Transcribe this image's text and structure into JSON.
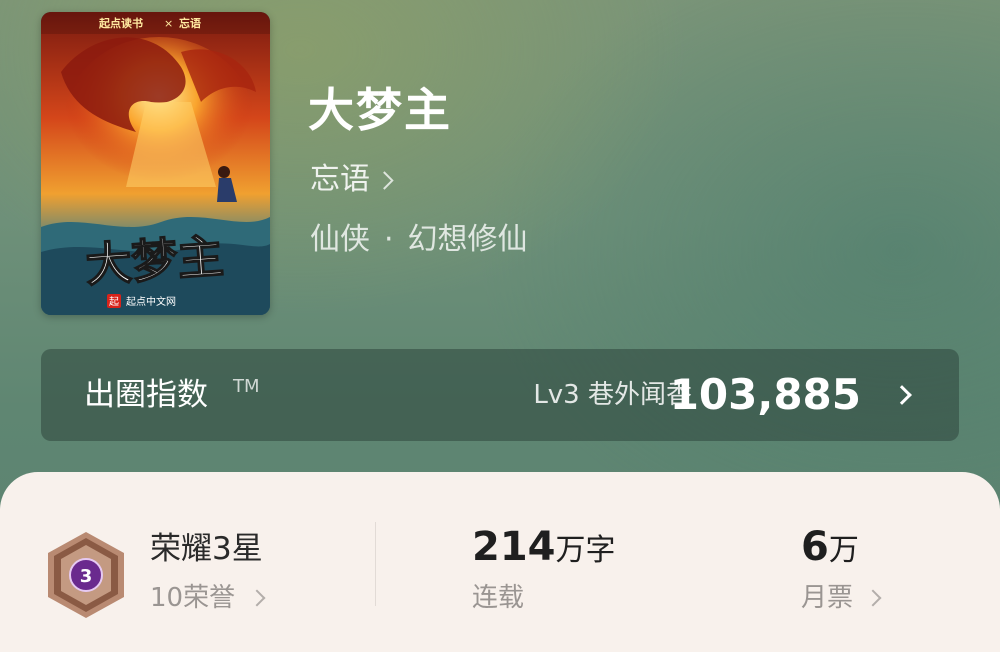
{
  "book": {
    "title": "大梦主",
    "author": "忘语",
    "genre_primary": "仙侠",
    "genre_separator": "·",
    "genre_secondary": "幻想修仙",
    "cover": {
      "top_logo_text": "起点读书",
      "top_cross": "×",
      "top_author": "忘语",
      "calligraphy_title": "大梦主",
      "publisher_badge": "起",
      "publisher_text": "起点中文网"
    }
  },
  "popularity_index": {
    "label": "出圈指数",
    "trademark": "TM",
    "level_text": "Lv3 巷外闻香",
    "score": "103,885"
  },
  "stats": {
    "honor_level": "3",
    "honor_title": "荣耀3星",
    "honor_points": "10荣誉",
    "word_count_number": "214",
    "word_count_unit": "万字",
    "status": "连载",
    "monthly_votes_number": "6",
    "monthly_votes_unit": "万",
    "monthly_votes_label": "月票"
  },
  "colors": {
    "header_bg": "#6e9079",
    "index_bar_bg": "#3f5a50",
    "card_bg": "#f8f1ec",
    "badge_purple": "#6a2a8e",
    "badge_bronze": "#a87a62"
  }
}
